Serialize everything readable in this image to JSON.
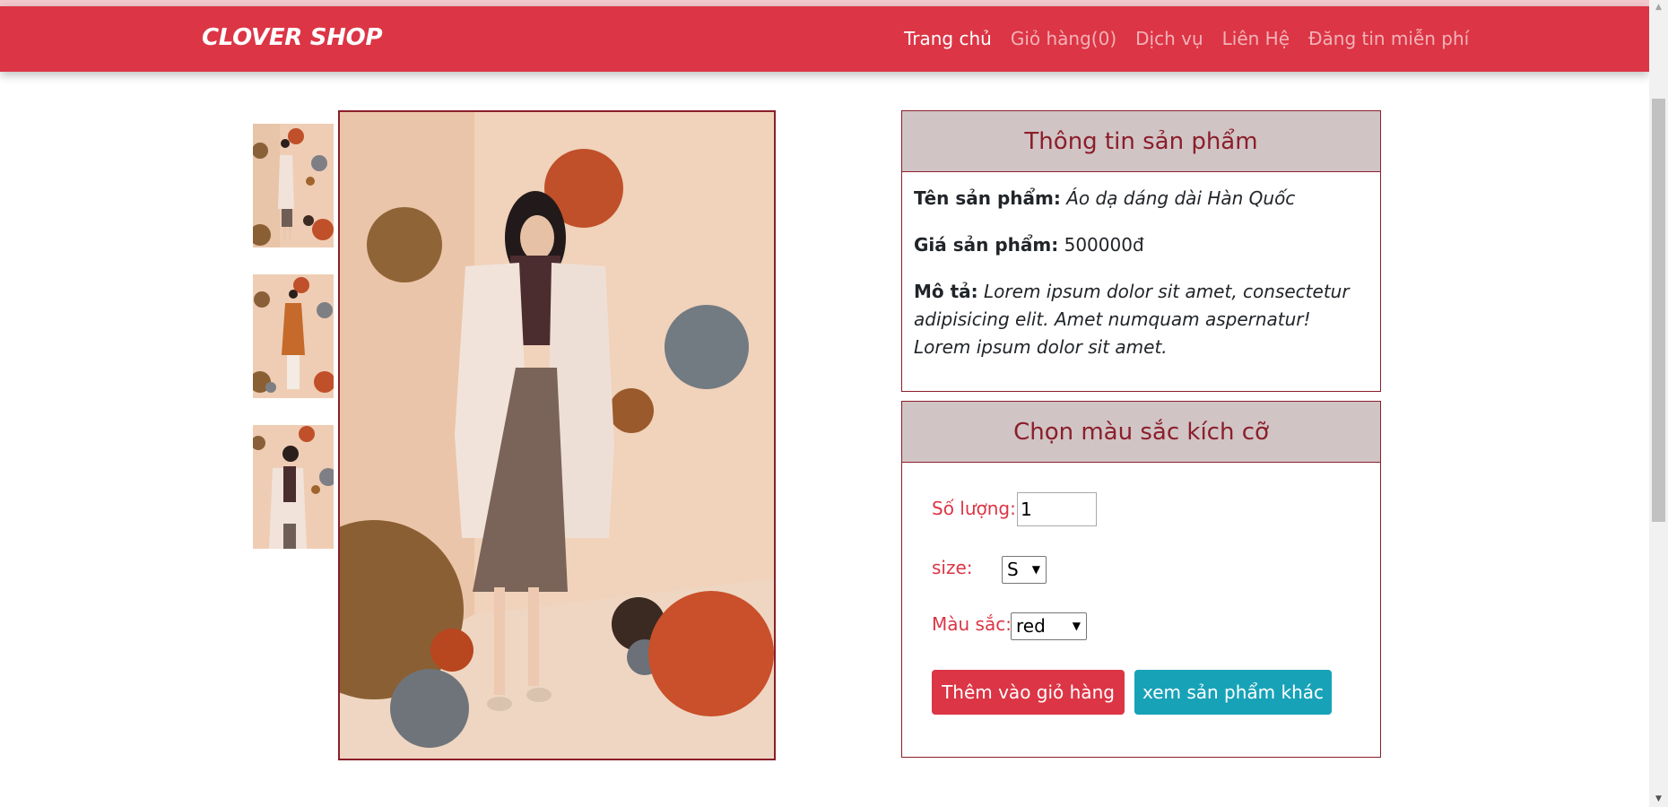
{
  "brand": "CLOVER SHOP",
  "nav": {
    "items": [
      {
        "label": "Trang chủ",
        "active": true
      },
      {
        "label": "Giỏ hàng(0)",
        "active": false
      },
      {
        "label": "Dịch vụ",
        "active": false
      },
      {
        "label": "Liên Hệ",
        "active": false
      },
      {
        "label": "Đăng tin miễn phí",
        "active": false
      }
    ]
  },
  "info_card": {
    "title": "Thông tin sản phẩm",
    "name_label": "Tên sản phẩm:",
    "name_value": "Áo dạ dáng dài Hàn Quốc",
    "price_label": "Giá sản phẩm:",
    "price_value": "500000đ",
    "desc_label": "Mô tả:",
    "desc_value": "Lorem ipsum dolor sit amet, consectetur adipisicing elit. Amet numquam aspernatur! Lorem ipsum dolor sit amet."
  },
  "options_card": {
    "title": "Chọn màu sắc kích cỡ",
    "qty_label": "Số lượng:",
    "qty_value": "1",
    "size_label": "size:",
    "size_value": "S",
    "color_label": "Màu sắc:",
    "color_value": "red",
    "add_to_cart": "Thêm vào giỏ hàng",
    "view_other": "xem sản phẩm khác"
  },
  "colors": {
    "primary": "#dc3545",
    "info": "#17a2b8",
    "accent_dark": "#8b1e2a",
    "header_bg": "#d1c4c5"
  }
}
